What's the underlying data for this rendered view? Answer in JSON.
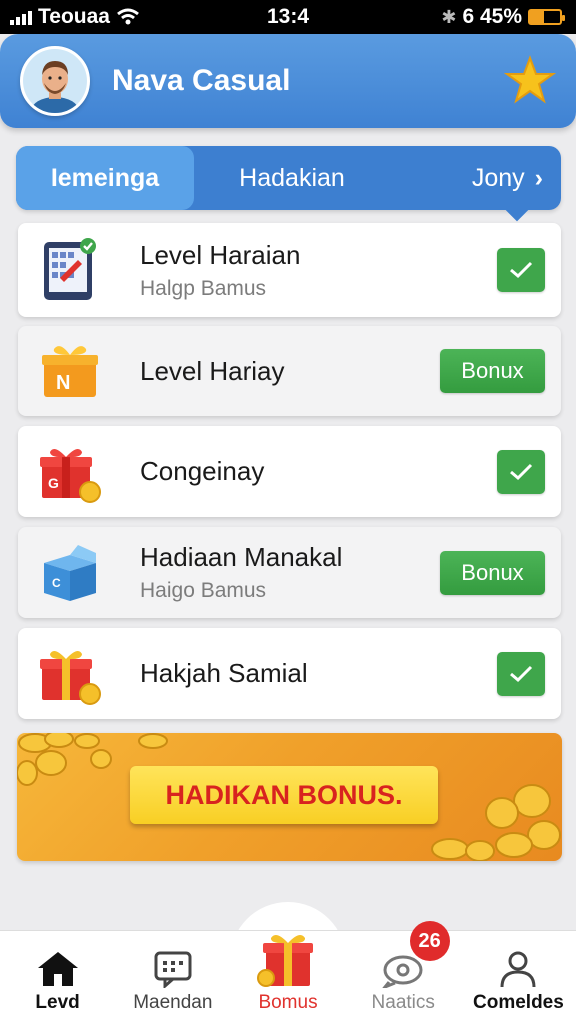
{
  "status_bar": {
    "carrier": "Teouaa",
    "time": "13:4",
    "battery_text": "6 45%",
    "battery_level": 0.45
  },
  "header": {
    "title": "Nava Casual",
    "avatar_icon": "avatar",
    "star_icon": "star-icon"
  },
  "tabs": [
    {
      "label": "Iemeinga",
      "active": true
    },
    {
      "label": "Hadakian",
      "active": false
    },
    {
      "label": "Jony",
      "active": false
    }
  ],
  "list": [
    {
      "title": "Level Haraian",
      "subtitle": "Halgp Bamus",
      "icon": "tablet-icon",
      "action": "check"
    },
    {
      "title": "Level Hariay",
      "subtitle": "",
      "icon": "orange-gift-icon",
      "action": "bonus",
      "action_label": "Bonux",
      "icon_letter": "N"
    },
    {
      "title": "Congeinay",
      "subtitle": "",
      "icon": "red-gift-icon",
      "action": "check",
      "icon_letter": "G"
    },
    {
      "title": "Hadiaan Manakal",
      "subtitle": "Haigo Bamus",
      "icon": "blue-box-icon",
      "action": "bonus",
      "action_label": "Bonux",
      "icon_letter": "C"
    },
    {
      "title": "Hakjah Samial",
      "subtitle": "",
      "icon": "red-gift-icon",
      "action": "check"
    }
  ],
  "banner": {
    "label": "HADIKAN BONUS."
  },
  "bottom_nav": [
    {
      "label": "Levd",
      "icon": "home-icon"
    },
    {
      "label": "Maendan",
      "icon": "chat-icon"
    },
    {
      "label": "Bomus",
      "icon": "gift-icon"
    },
    {
      "label": "Naatics",
      "icon": "notifications-icon",
      "badge": "26"
    },
    {
      "label": "Comeldes",
      "icon": "person-icon"
    }
  ],
  "colors": {
    "header_blue": "#4a8fdc",
    "tab_blue": "#3d7fd0",
    "tab_active": "#5aa2e8",
    "green": "#3fa64b",
    "banner_orange": "#f0a02a",
    "banner_label_red": "#d8231f",
    "badge_red": "#e02b2b"
  }
}
